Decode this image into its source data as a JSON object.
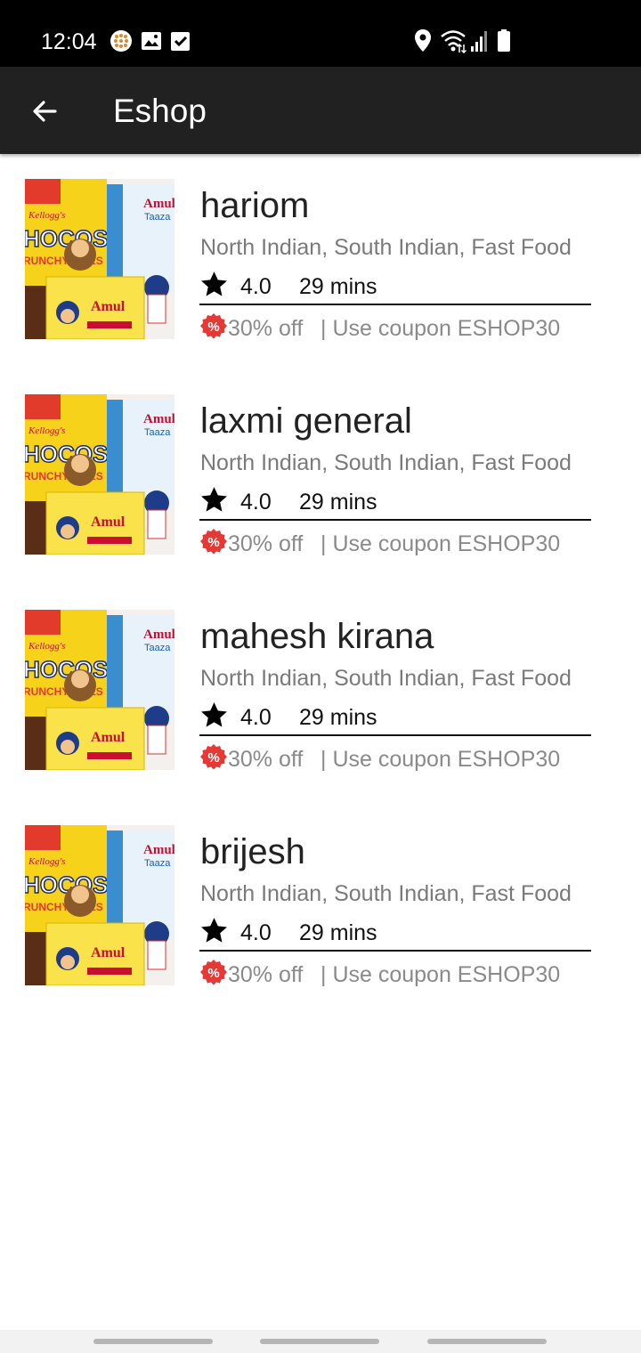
{
  "status_bar": {
    "time": "12:04",
    "left_icons": [
      "app-notification-icon",
      "image-icon",
      "check-box-icon"
    ],
    "right_icons": [
      "location-icon",
      "wifi-icon",
      "signal-icon",
      "battery-icon"
    ]
  },
  "app_bar": {
    "back_icon": "arrow-left-icon",
    "title": "Eshop"
  },
  "stores": [
    {
      "name": "hariom",
      "cuisine": "North Indian, South Indian, Fast Food",
      "rating": "4.0",
      "eta": "29 mins",
      "offer": "30% off",
      "coupon": "| Use coupon ESHOP30"
    },
    {
      "name": "laxmi general",
      "cuisine": "North Indian, South Indian, Fast Food",
      "rating": "4.0",
      "eta": "29 mins",
      "offer": "30% off",
      "coupon": "| Use coupon ESHOP30"
    },
    {
      "name": "mahesh kirana",
      "cuisine": "North Indian, South Indian, Fast Food",
      "rating": "4.0",
      "eta": "29 mins",
      "offer": "30% off",
      "coupon": "| Use coupon ESHOP30"
    },
    {
      "name": "brijesh",
      "cuisine": "North Indian, South Indian, Fast Food",
      "rating": "4.0",
      "eta": "29 mins",
      "offer": "30% off",
      "coupon": "| Use coupon ESHOP30"
    }
  ],
  "product_image": {
    "brand_left": "HOCOS",
    "brand_right": "Amul",
    "sub_right": "Taaza",
    "butter_label": "Amul",
    "kelloggs": "Kellogg's",
    "crunchy": "RUNCHY BITES"
  },
  "colors": {
    "app_bar": "#212121",
    "status_bar": "#000000",
    "offer_badge": "#e53935",
    "secondary_text": "#7a7a7a"
  }
}
